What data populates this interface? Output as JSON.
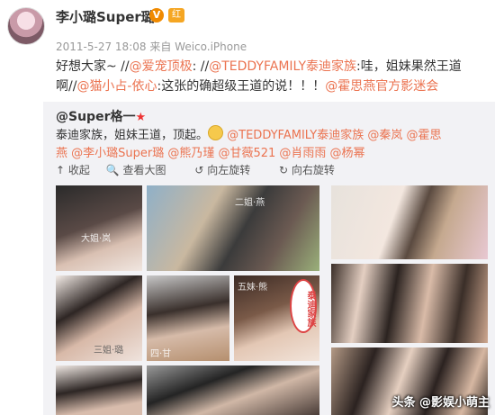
{
  "author": {
    "name": "李小璐Super璐",
    "verified_badge": "V",
    "fan_badge": "红"
  },
  "meta": {
    "time": "2011-5-27 18:08",
    "source_prefix": "来自",
    "source": "Weico.iPhone"
  },
  "post": {
    "p1": "好想大家~ //",
    "m1": "@爱宠顶极",
    "p2": ": //",
    "m2": "@TEDDYFAMILY泰迪家族",
    "p3": ":哇，姐妹果然王道啊//",
    "m3": "@猫小占-依心",
    "p4": ":这张的确超级王道的说！！！",
    "m4": "@霍思燕官方影迷会"
  },
  "repost": {
    "author": "@Super格一",
    "star": "★",
    "text1": "泰迪家族，姐妹王道，顶起。",
    "mentions": "@TEDDYFAMILY泰迪家族 @秦岚 @霍思燕 @李小璐Super璐 @熊乃瑾 @甘薇521 @肖雨雨 @杨幂"
  },
  "toolbar": {
    "collapse": "↑ 收起",
    "view_large": "查看大图",
    "rotate_left": "向左旋转",
    "rotate_right": "向右旋转"
  },
  "photos": {
    "cap1": "大姐·岚",
    "cap2": "二姐·燕",
    "cap3": "三姐·璐",
    "cap4": "四·甘",
    "cap5": "五妹·熊",
    "tag": "泰迪家族"
  },
  "watermark": "头条 @影娱小萌主"
}
